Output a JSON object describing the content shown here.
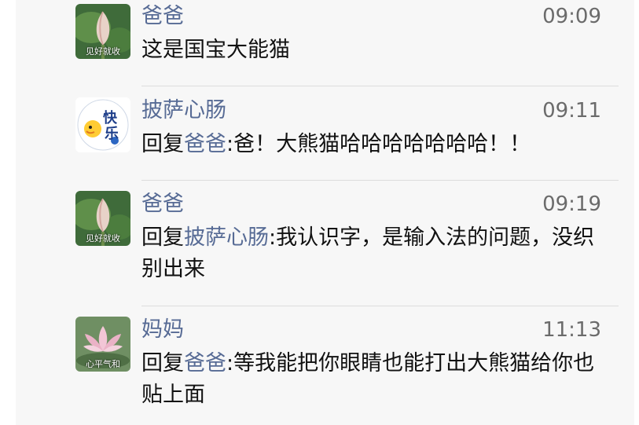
{
  "comments": [
    {
      "author": "爸爸",
      "time": "09:09",
      "avatar_label": "见好就收",
      "body": "这是国宝大能猫"
    },
    {
      "author": "披萨心肠",
      "time": "09:11",
      "reply_prefix": "回复",
      "reply_to": "爸爸",
      "body": ":爸！大熊猫哈哈哈哈哈哈哈！！"
    },
    {
      "author": "爸爸",
      "time": "09:19",
      "avatar_label": "见好就收",
      "reply_prefix": "回复",
      "reply_to": "披萨心肠",
      "body": ":我认识字，是输入法的问题，没织别出来"
    },
    {
      "author": "妈妈",
      "time": "11:13",
      "avatar_label": "心平气和",
      "reply_prefix": "回复",
      "reply_to": "爸爸",
      "body": ":等我能把你眼睛也能打出大熊猫给你也贴上面"
    }
  ],
  "avatar2_text": {
    "kuai": "快",
    "le": "乐"
  }
}
